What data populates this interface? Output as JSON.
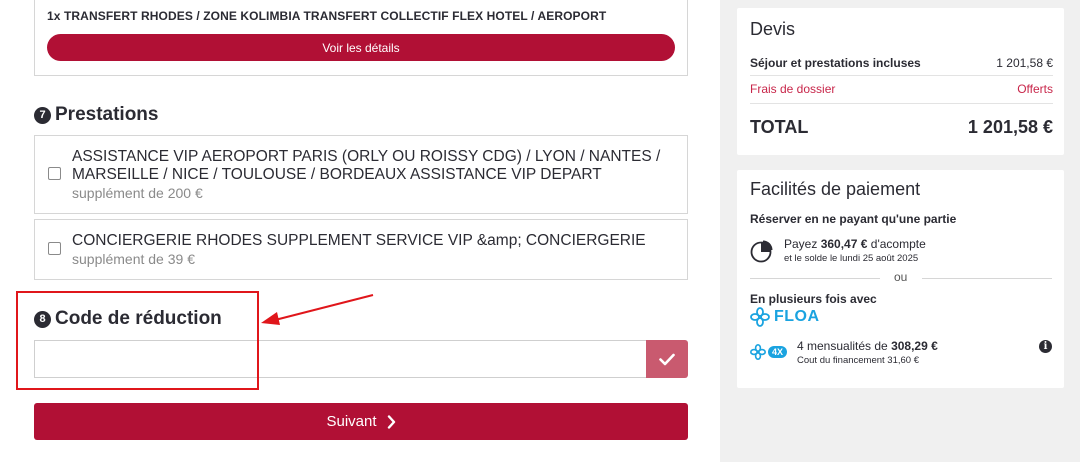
{
  "transfer": {
    "title": "1x TRANSFERT RHODES / ZONE KOLIMBIA TRANSFERT COLLECTIF FLEX HOTEL / AEROPORT",
    "details_button": "Voir les détails"
  },
  "prestations": {
    "step": "7",
    "title": "Prestations",
    "options": [
      {
        "label": "ASSISTANCE VIP AEROPORT PARIS (ORLY OU ROISSY CDG) / LYON / NANTES / MARSEILLE / NICE / TOULOUSE / BORDEAUX ASSISTANCE VIP DEPART",
        "price": "supplément de 200 €",
        "checked": false
      },
      {
        "label": "CONCIERGERIE RHODES SUPPLEMENT SERVICE VIP &amp; CONCIERGERIE",
        "price": "supplément de 39 €",
        "checked": false
      }
    ]
  },
  "reduction": {
    "step": "8",
    "title": "Code de réduction",
    "value": "",
    "placeholder": ""
  },
  "next_button": "Suivant",
  "quote": {
    "title": "Devis",
    "rows": [
      {
        "label": "Séjour et prestations incluses",
        "value": "1 201,58 €"
      },
      {
        "label": "Frais de dossier",
        "value": "Offerts"
      }
    ],
    "total_label": "TOTAL",
    "total_value": "1 201,58 €"
  },
  "payment": {
    "title": "Facilités de paiement",
    "partial_title": "Réserver en ne payant qu'une partie",
    "deposit_prefix": "Payez",
    "deposit_amount": "360,47 €",
    "deposit_suffix": "d'acompte",
    "balance_text": "et le solde le lundi 25 août 2025",
    "or": "ou",
    "installments_title": "En plusieurs fois avec",
    "floa_logo": "FLOA",
    "badge": "4X",
    "installments_prefix": "4 mensualités de",
    "installments_amount": "308,29 €",
    "financing_cost": "Cout du financement 31,60 €"
  },
  "colors": {
    "brand": "#b11035",
    "fees": "#c8264a",
    "floa": "#1aa3e0",
    "annotation": "#e0161b"
  },
  "icons": {
    "check": "check-icon",
    "chevron": "chevron-right-icon",
    "pie": "pie-chart-icon",
    "info": "info-icon",
    "floa": "floa-flower-icon"
  }
}
